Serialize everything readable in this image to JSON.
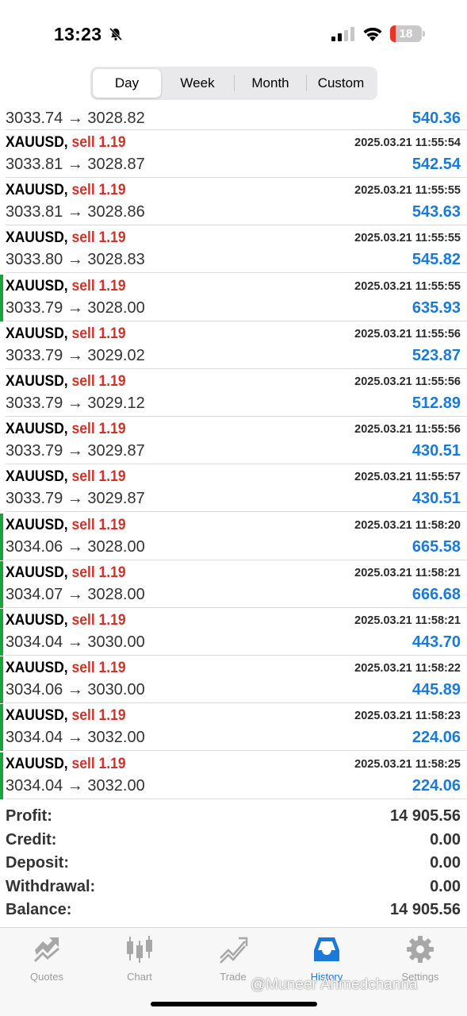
{
  "status_bar": {
    "time": "13:23",
    "battery": "18",
    "battery_level": 0.18
  },
  "period_tabs": [
    {
      "label": "Day",
      "active": true
    },
    {
      "label": "Week",
      "active": false
    },
    {
      "label": "Month",
      "active": false
    },
    {
      "label": "Custom",
      "active": false
    }
  ],
  "deals": [
    {
      "symbol": "",
      "side": "",
      "time": "",
      "prices": "3033.74 → 3028.82",
      "profit": "540.36",
      "marked": false,
      "partial": true
    },
    {
      "symbol": "XAUUSD,",
      "side": "sell 1.19",
      "time": "2025.03.21 11:55:54",
      "prices": "3033.81 → 3028.87",
      "profit": "542.54",
      "marked": false
    },
    {
      "symbol": "XAUUSD,",
      "side": "sell 1.19",
      "time": "2025.03.21 11:55:55",
      "prices": "3033.81 → 3028.86",
      "profit": "543.63",
      "marked": false
    },
    {
      "symbol": "XAUUSD,",
      "side": "sell 1.19",
      "time": "2025.03.21 11:55:55",
      "prices": "3033.80 → 3028.83",
      "profit": "545.82",
      "marked": false
    },
    {
      "symbol": "XAUUSD,",
      "side": "sell 1.19",
      "time": "2025.03.21 11:55:55",
      "prices": "3033.79 → 3028.00",
      "profit": "635.93",
      "marked": true
    },
    {
      "symbol": "XAUUSD,",
      "side": "sell 1.19",
      "time": "2025.03.21 11:55:56",
      "prices": "3033.79 → 3029.02",
      "profit": "523.87",
      "marked": false
    },
    {
      "symbol": "XAUUSD,",
      "side": "sell 1.19",
      "time": "2025.03.21 11:55:56",
      "prices": "3033.79 → 3029.12",
      "profit": "512.89",
      "marked": false
    },
    {
      "symbol": "XAUUSD,",
      "side": "sell 1.19",
      "time": "2025.03.21 11:55:56",
      "prices": "3033.79 → 3029.87",
      "profit": "430.51",
      "marked": false
    },
    {
      "symbol": "XAUUSD,",
      "side": "sell 1.19",
      "time": "2025.03.21 11:55:57",
      "prices": "3033.79 → 3029.87",
      "profit": "430.51",
      "marked": false
    },
    {
      "symbol": "XAUUSD,",
      "side": "sell 1.19",
      "time": "2025.03.21 11:58:20",
      "prices": "3034.06 → 3028.00",
      "profit": "665.58",
      "marked": true
    },
    {
      "symbol": "XAUUSD,",
      "side": "sell 1.19",
      "time": "2025.03.21 11:58:21",
      "prices": "3034.07 → 3028.00",
      "profit": "666.68",
      "marked": true
    },
    {
      "symbol": "XAUUSD,",
      "side": "sell 1.19",
      "time": "2025.03.21 11:58:21",
      "prices": "3034.04 → 3030.00",
      "profit": "443.70",
      "marked": true
    },
    {
      "symbol": "XAUUSD,",
      "side": "sell 1.19",
      "time": "2025.03.21 11:58:22",
      "prices": "3034.06 → 3030.00",
      "profit": "445.89",
      "marked": true
    },
    {
      "symbol": "XAUUSD,",
      "side": "sell 1.19",
      "time": "2025.03.21 11:58:23",
      "prices": "3034.04 → 3032.00",
      "profit": "224.06",
      "marked": true
    },
    {
      "symbol": "XAUUSD,",
      "side": "sell 1.19",
      "time": "2025.03.21 11:58:25",
      "prices": "3034.04 → 3032.00",
      "profit": "224.06",
      "marked": true
    }
  ],
  "summary": [
    {
      "label": "Profit:",
      "value": "14 905.56"
    },
    {
      "label": "Credit:",
      "value": "0.00"
    },
    {
      "label": "Deposit:",
      "value": "0.00"
    },
    {
      "label": "Withdrawal:",
      "value": "0.00"
    },
    {
      "label": "Balance:",
      "value": "14 905.56"
    }
  ],
  "tab_bar": [
    {
      "label": "Quotes",
      "icon": "quotes-icon",
      "active": false
    },
    {
      "label": "Chart",
      "icon": "chart-candles-icon",
      "active": false
    },
    {
      "label": "Trade",
      "icon": "trade-icon",
      "active": false
    },
    {
      "label": "History",
      "icon": "history-inbox-icon",
      "active": true
    },
    {
      "label": "Settings",
      "icon": "settings-gear-icon",
      "active": false
    }
  ],
  "watermark": "@Muneer Ahmedchanna",
  "colors": {
    "sell": "#d62f26",
    "profit": "#1a7ad9",
    "marker": "#1aa33a",
    "tab_active": "#1a7ad9",
    "tab_inactive": "#9b9b9b"
  }
}
